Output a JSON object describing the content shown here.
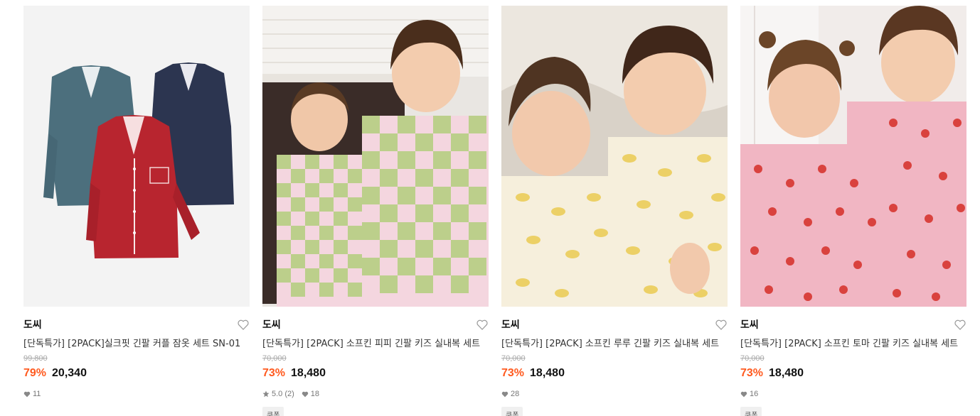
{
  "products": [
    {
      "brand": "도씨",
      "title": "[단독특가] [2PACK]실크핏 긴팔 커플 잠옷 세트 SN-01",
      "original_price": "99,800",
      "discount": "79%",
      "price": "20,340",
      "rating": "",
      "likes": "11",
      "badge": ""
    },
    {
      "brand": "도씨",
      "title": "[단독특가] [2PACK] 소프킨 피피 긴팔 키즈 실내복 세트",
      "original_price": "70,000",
      "discount": "73%",
      "price": "18,480",
      "rating": "5.0 (2)",
      "likes": "18",
      "badge": "쿠폰"
    },
    {
      "brand": "도씨",
      "title": "[단독특가] [2PACK] 소프킨 루루 긴팔 키즈 실내복 세트",
      "original_price": "70,000",
      "discount": "73%",
      "price": "18,480",
      "rating": "",
      "likes": "28",
      "badge": "쿠폰"
    },
    {
      "brand": "도씨",
      "title": "[단독특가] [2PACK] 소프킨 토마 긴팔 키즈 실내복 세트",
      "original_price": "70,000",
      "discount": "73%",
      "price": "18,480",
      "rating": "",
      "likes": "16",
      "badge": "쿠폰"
    }
  ],
  "colors": {
    "discount": "#ff5a1f",
    "original_price": "#aaaaaa"
  },
  "icons": {
    "wishlist": "heart-outline-icon",
    "likes": "heart-filled-icon",
    "rating": "star-icon"
  }
}
